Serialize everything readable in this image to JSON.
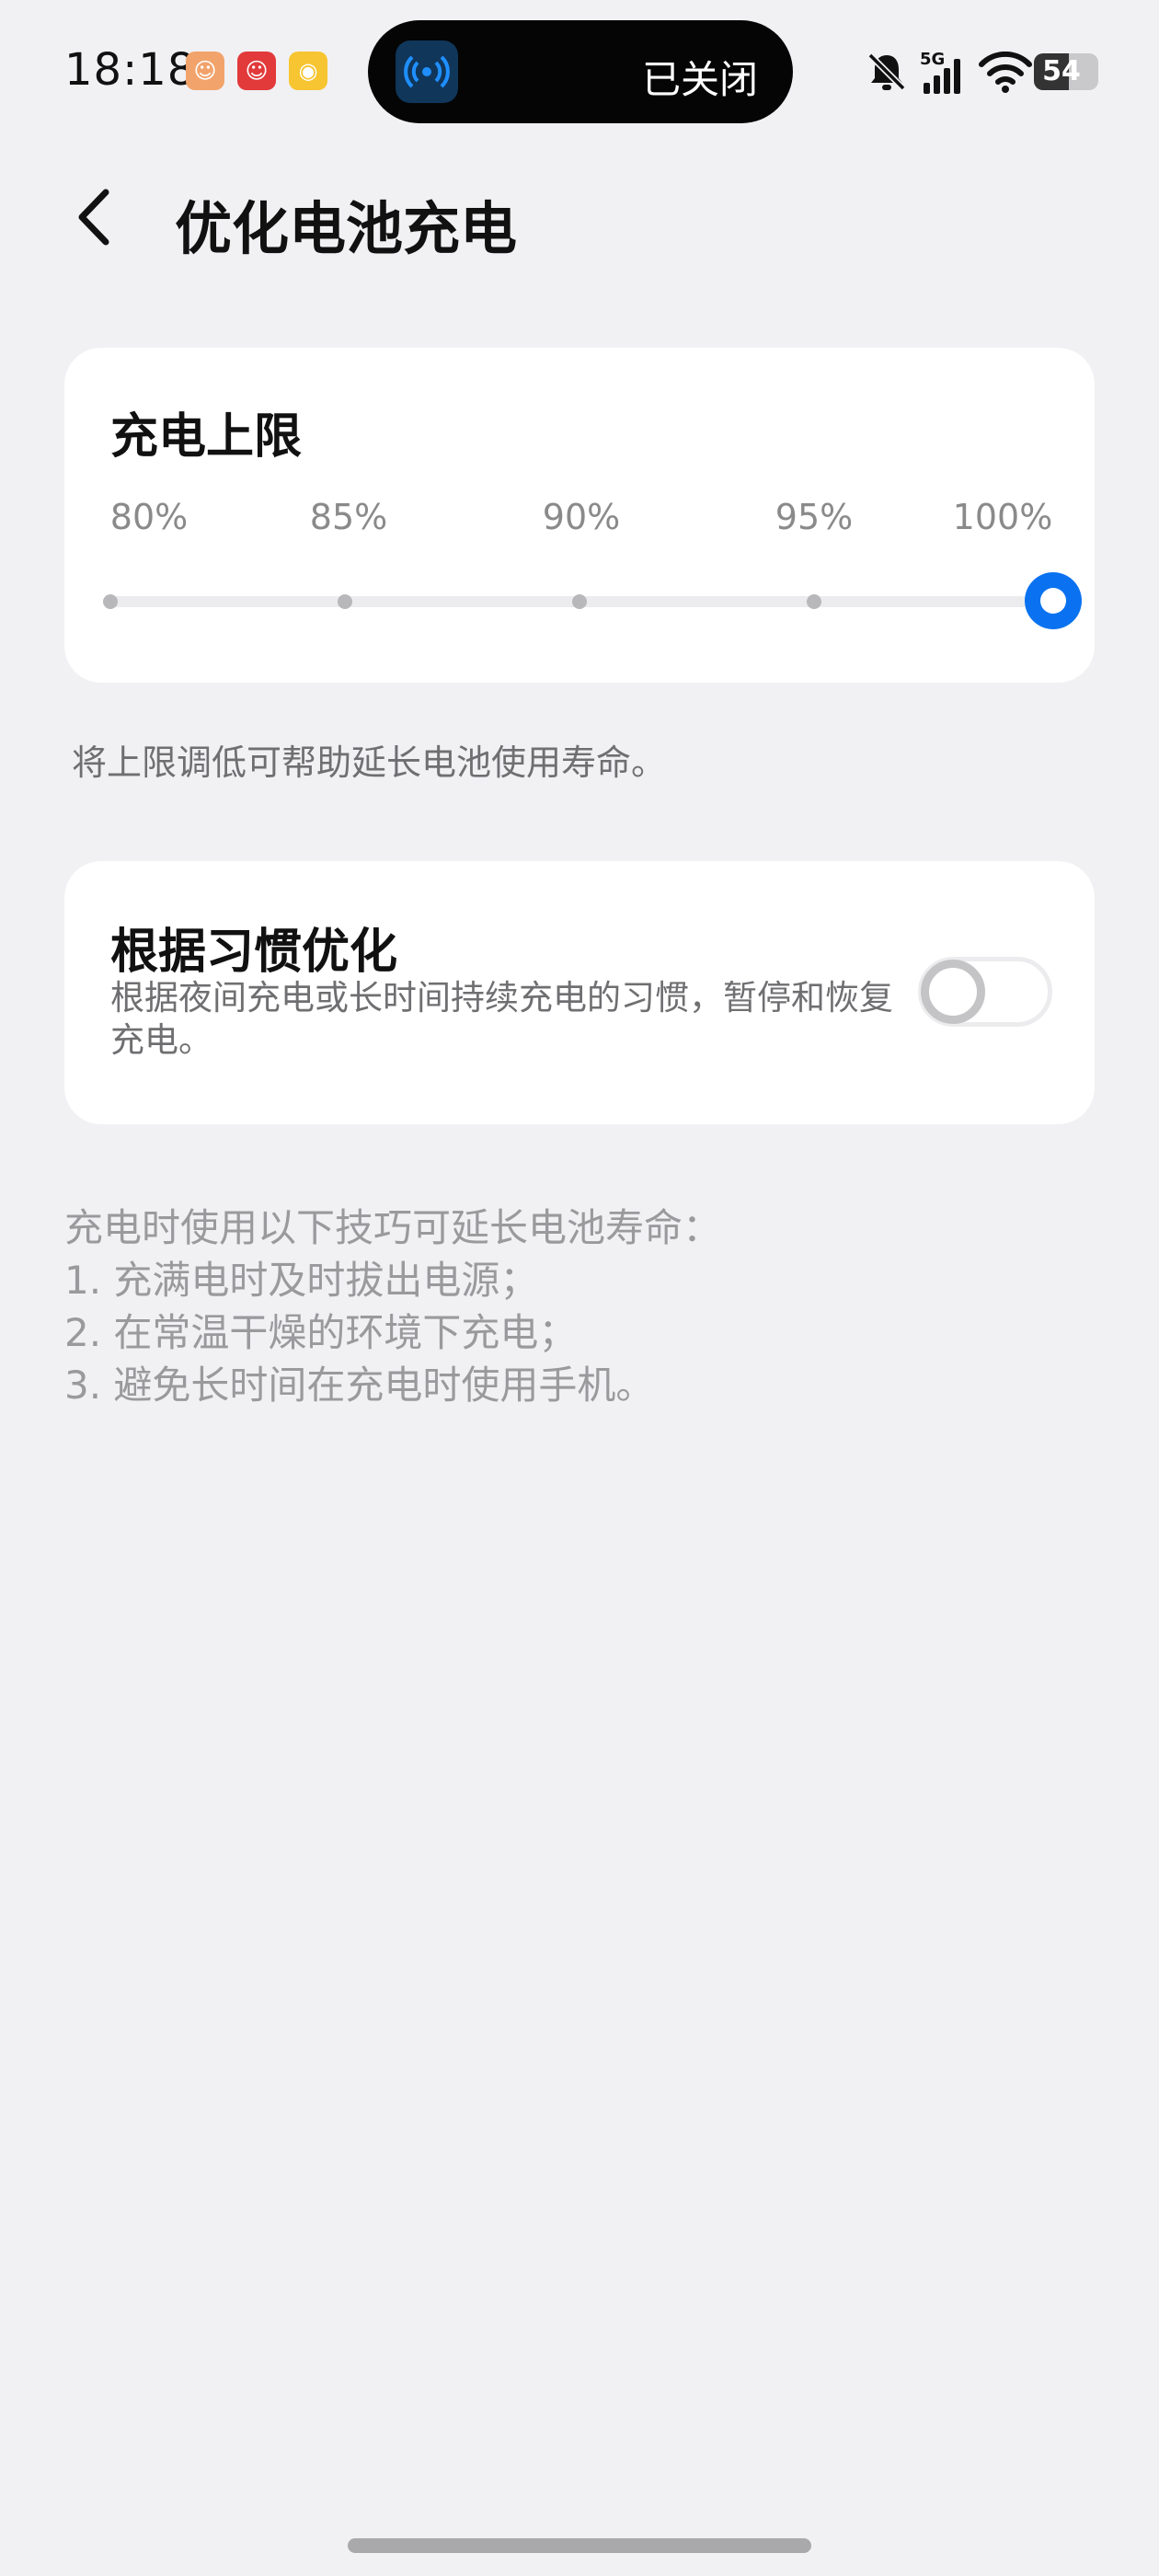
{
  "status_bar": {
    "time": "18:18",
    "app_icons": [
      "pet-app-icon",
      "santa-app-icon",
      "weibo-app-icon"
    ],
    "island_text": "已关闭",
    "network": "5G",
    "battery_level": "54",
    "battery_fraction": 0.54
  },
  "header": {
    "title": "优化电池充电"
  },
  "charge_limit": {
    "title": "充电上限",
    "ticks": [
      "80%",
      "85%",
      "90%",
      "95%",
      "100%"
    ],
    "selected": "100%",
    "hint": "将上限调低可帮助延长电池使用寿命。"
  },
  "habit": {
    "title": "根据习惯优化",
    "description": "根据夜间充电或长时间持续充电的习惯，暂停和恢复充电。",
    "enabled": false
  },
  "tips": {
    "heading": "充电时使用以下技巧可延长电池寿命：",
    "items": [
      "1. 充满电时及时拔出电源；",
      "2. 在常温干燥的环境下充电；",
      "3. 避免长时间在充电时使用手机。"
    ]
  },
  "colors": {
    "accent": "#0a72f0",
    "background": "#f1f1f4",
    "card": "#ffffff"
  }
}
